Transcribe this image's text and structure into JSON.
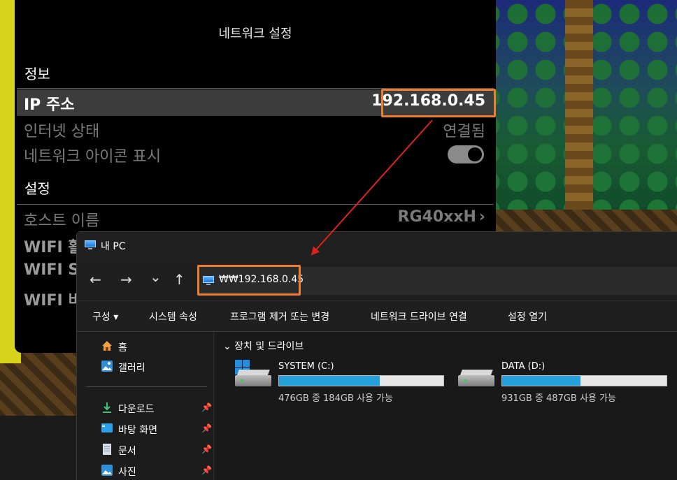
{
  "settings": {
    "title": "네트워크 설정",
    "section_info": "정보",
    "ip_label": "IP 주소",
    "ip_value": "192.168.0.45",
    "internet_label": "인터넷 상태",
    "internet_value": "연결됨",
    "net_icon_label": "네트워크 아이콘 표시",
    "net_icon_toggle": "on",
    "section_settings": "설정",
    "hostname_label": "호스트 이름",
    "hostname_value": "RG40xxH",
    "wifi1_label": "WIFI 활",
    "wifi2_label": "WIFI SS",
    "wifi3_label": "WIFI 비"
  },
  "explorer": {
    "title": "내 PC",
    "address": "₩₩192.168.0.45",
    "nav": {
      "back": "←",
      "forward": "→",
      "recent": "⌄",
      "up": "↑"
    },
    "commands": [
      "구성 ▾",
      "시스템 속성",
      "프로그램 제거 또는 변경",
      "네트워크 드라이브 연결",
      "설정 열기"
    ],
    "sidebar": {
      "home": "홈",
      "gallery": "갤러리",
      "downloads": "다운로드",
      "desktop": "바탕 화면",
      "documents": "문서",
      "pictures": "사진"
    },
    "group_header": "⌄ 장치 및 드라이브",
    "drives": [
      {
        "name": "SYSTEM (C:)",
        "detail": "476GB 중 184GB 사용 가능",
        "used_fraction": 0.613
      },
      {
        "name": "DATA (D:)",
        "detail": "931GB 중 487GB 사용 가능",
        "used_fraction": 0.477
      }
    ]
  },
  "colors": {
    "highlight": "#ed7d31",
    "arrow": "#e0201b",
    "drive_fill": "#26a0da"
  }
}
